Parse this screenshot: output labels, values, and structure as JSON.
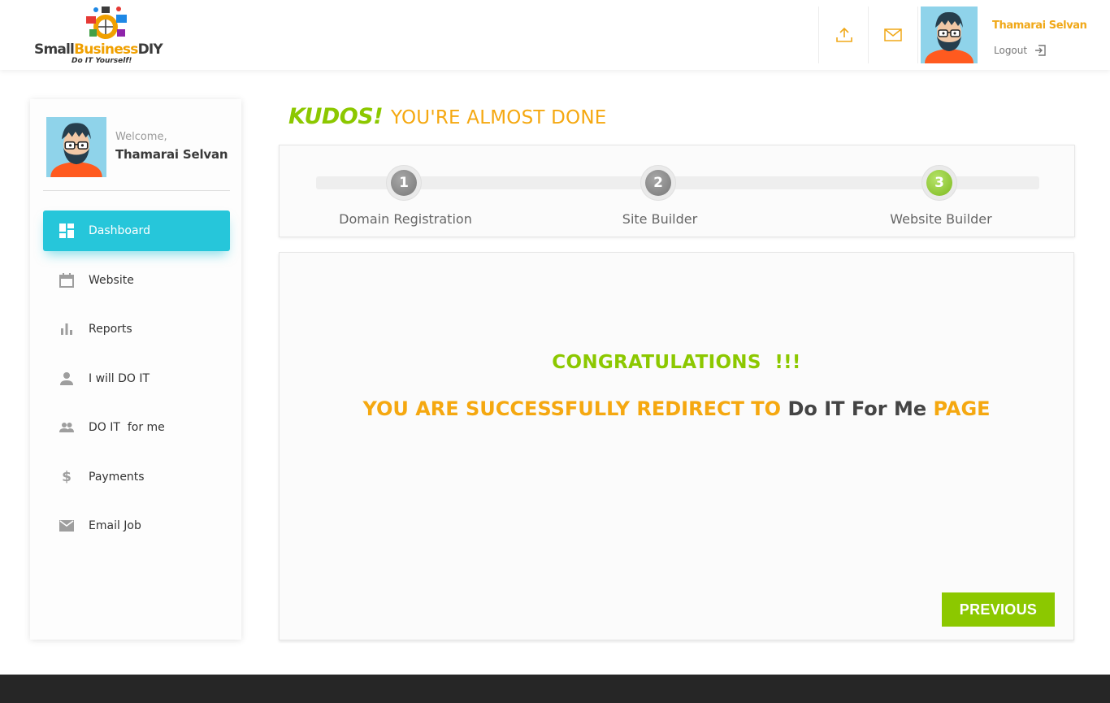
{
  "header": {
    "logo": {
      "word_part1": "Small",
      "word_part2": "Business",
      "word_part3": "DIY",
      "tagline": "Do IT Yourself!"
    },
    "upload_icon": "upload-icon",
    "mail_icon": "mail-icon",
    "user_name": "Thamarai Selvan",
    "logout_label": "Logout",
    "logout_icon": "logout-icon"
  },
  "sidebar": {
    "welcome": "Welcome,",
    "user_name": "Thamarai Selvan",
    "items": [
      {
        "label": "Dashboard",
        "icon": "dashboard-icon",
        "active": true
      },
      {
        "label": "Website",
        "icon": "calendar-icon",
        "active": false
      },
      {
        "label": "Reports",
        "icon": "bar-chart-icon",
        "active": false
      },
      {
        "label": "I will DO IT",
        "icon": "person-icon",
        "active": false
      },
      {
        "label": "DO IT  for me",
        "icon": "people-icon",
        "active": false
      },
      {
        "label": "Payments",
        "icon": "dollar-icon",
        "active": false
      },
      {
        "label": "Email Job",
        "icon": "envelope-icon",
        "active": false
      }
    ]
  },
  "main": {
    "kudos": "KUDOS!",
    "almost_done": "YOU'RE ALMOST DONE",
    "steps": [
      {
        "number": "1",
        "label": "Domain Registration",
        "complete": false
      },
      {
        "number": "2",
        "label": "Site Builder",
        "complete": false
      },
      {
        "number": "3",
        "label": "Website Builder",
        "complete": true
      }
    ],
    "congratulations": "CONGRATULATIONS  !!!",
    "redirect_prefix": "YOU ARE SUCCESSFULLY REDIRECT TO",
    "redirect_target": "Do IT For Me",
    "redirect_suffix": "PAGE",
    "previous_button": "PREVIOUS"
  },
  "colors": {
    "accent_cyan": "#26c6da",
    "green": "#8cc800",
    "orange": "#f5a810",
    "footer": "#262626"
  }
}
